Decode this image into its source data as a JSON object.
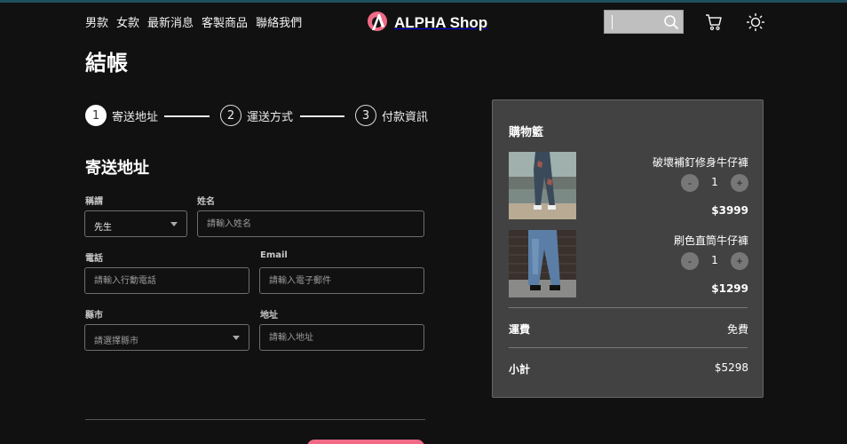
{
  "nav": [
    "男款",
    "女款",
    "最新消息",
    "客製商品",
    "聯絡我們"
  ],
  "brand": {
    "name": "ALPHA Shop",
    "logo_color": "#f06a86"
  },
  "search": {
    "value": ""
  },
  "icons": {
    "search": "search-icon",
    "cart": "cart-icon",
    "theme": "sun-icon"
  },
  "page_title": "結帳",
  "stepper": [
    {
      "num": "1",
      "label": "寄送地址",
      "active": true
    },
    {
      "num": "2",
      "label": "運送方式",
      "active": false
    },
    {
      "num": "3",
      "label": "付款資訊",
      "active": false
    }
  ],
  "section_title": "寄送地址",
  "form": {
    "salutation": {
      "label": "稱謂",
      "value": "先生"
    },
    "name": {
      "label": "姓名",
      "placeholder": "請輸入姓名"
    },
    "phone": {
      "label": "電話",
      "placeholder": "請輸入行動電話"
    },
    "email": {
      "label": "Email",
      "placeholder": "請輸入電子郵件"
    },
    "city": {
      "label": "縣市",
      "placeholder": "請選擇縣市"
    },
    "address": {
      "label": "地址",
      "placeholder": "請輸入地址"
    }
  },
  "cart": {
    "title": "購物籃",
    "items": [
      {
        "name": "破壞補釘修身牛仔褲",
        "qty": "1",
        "price": "$3999",
        "minus": "-",
        "plus": "+"
      },
      {
        "name": "刷色直筒牛仔褲",
        "qty": "1",
        "price": "$1299",
        "minus": "-",
        "plus": "+"
      }
    ],
    "shipping": {
      "label": "運費",
      "value": "免費"
    },
    "subtotal": {
      "label": "小計",
      "value": "$5298"
    }
  },
  "colors": {
    "accent": "#f06a86",
    "background": "#111112",
    "panel": "#424242"
  }
}
